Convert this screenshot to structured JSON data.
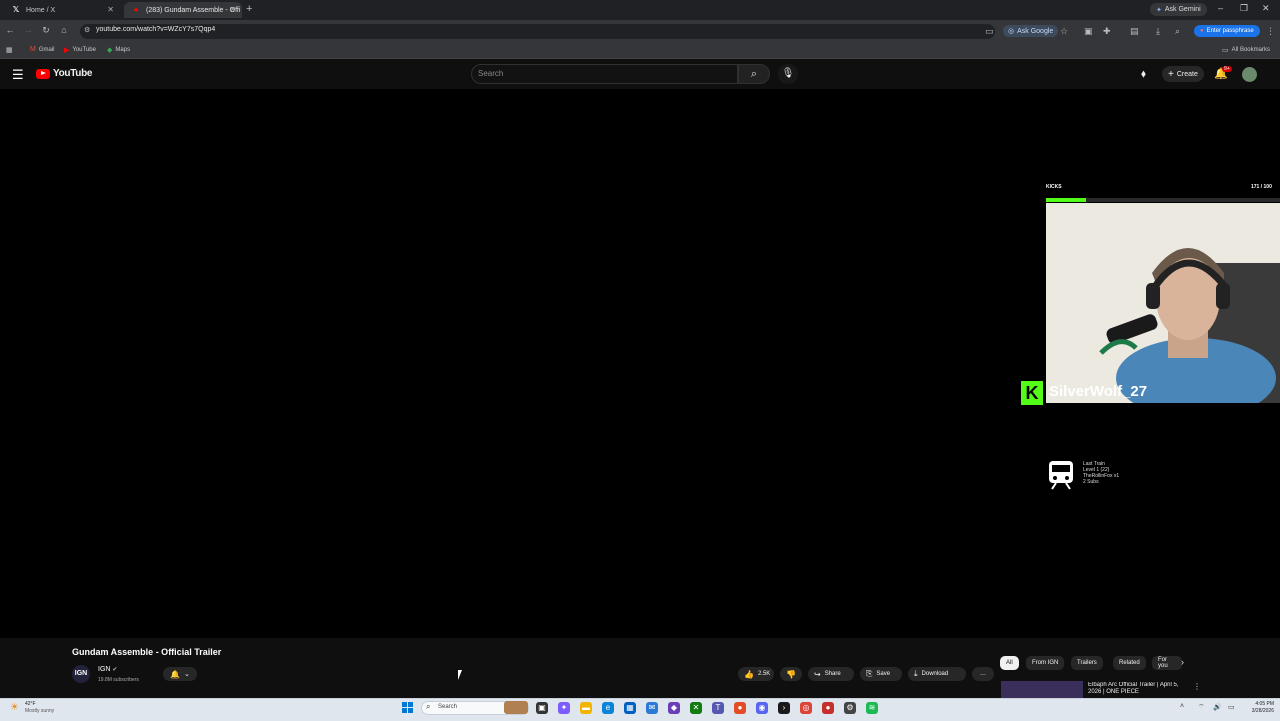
{
  "browser": {
    "tabs": [
      {
        "label": "Home / X",
        "icon": "x-icon"
      },
      {
        "label": "(283) Gundam Assemble - Offi",
        "icon": "youtube-icon"
      }
    ],
    "new_tab": "+",
    "gemini": "Ask Gemini",
    "window_controls": {
      "minimize": "–",
      "restore": "❐",
      "close": "✕"
    },
    "url": "youtube.com/watch?v=WZcY7s7Qqp4",
    "ask_google": "Ask Google",
    "enter_passphrase": "Enter passphrase",
    "bookmarks": [
      {
        "label": "Gmail",
        "icon": "gmail-icon"
      },
      {
        "label": "YouTube",
        "icon": "youtube-icon"
      },
      {
        "label": "Maps",
        "icon": "maps-icon"
      }
    ],
    "all_bookmarks": "All Bookmarks"
  },
  "youtube": {
    "logo_text": "YouTube",
    "search_placeholder": "Search",
    "create_label": "Create",
    "notifications_badge": "9+",
    "video": {
      "overlay": {
        "kicks_label": "KICKS",
        "kicks_count": "171 / 100",
        "kicks_progress": 0.17,
        "streamer_name": "SilverWolf_27",
        "train_lines": [
          "Last Train",
          "Level 1  (22)",
          "TheRollinFox x1",
          "2 Subs"
        ]
      }
    },
    "title": "Gundam Assemble - Official Trailer",
    "channel": {
      "avatar_text": "IGN",
      "name": "IGN",
      "subscribers": "19.8M subscribers"
    },
    "actions": {
      "likes": "2.5K",
      "share": "Share",
      "save": "Save",
      "download": "Download",
      "more": "…"
    },
    "chips": [
      "All",
      "From IGN",
      "Trailers",
      "Related",
      "For you"
    ],
    "recommendation": {
      "title": "Elbaph Arc Official Trailer | April 5, 2026 | ONE PIECE"
    }
  },
  "taskbar": {
    "weather_temp": "42°F",
    "weather_desc": "Mostly sunny",
    "search": "Search",
    "time": "4:05 PM",
    "date": "3/28/2026"
  },
  "colors": {
    "kick_green": "#53fc18",
    "youtube_red": "#ff0000",
    "windows_blue": "#0078d4"
  }
}
